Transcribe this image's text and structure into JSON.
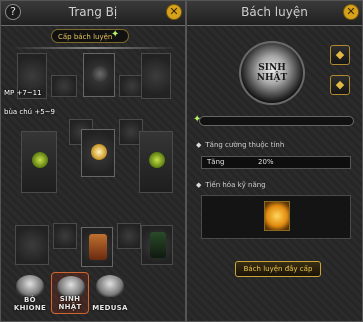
{
  "left_panel": {
    "title": "Trang Bị",
    "help_glyph": "?",
    "close_glyph": "✕",
    "tab_label": "Cấp bách luyện",
    "stats": [
      "MP +7~11",
      "bùa chú +5~9"
    ],
    "heroes": [
      {
        "name": "BÒ\nKHIONE",
        "selected": false
      },
      {
        "name": "SINH\nNHẬT",
        "selected": true
      },
      {
        "name": "MEDUSA",
        "selected": false
      }
    ]
  },
  "right_panel": {
    "title": "Bách luyện",
    "close_glyph": "✕",
    "emblem_text": "SINH\nNHẬT",
    "section_attr_title": "Tăng cường thuộc tính",
    "attr_label": "Tăng",
    "attr_value": "20%",
    "section_skill_title": "Tiến hóa kỹ năng",
    "upgrade_button": "Bách luyện đầy cấp"
  },
  "colors": {
    "accent_gold": "#e8c45a",
    "close_button": "#d6a21c",
    "hero_selected_border": "#cc6633"
  }
}
